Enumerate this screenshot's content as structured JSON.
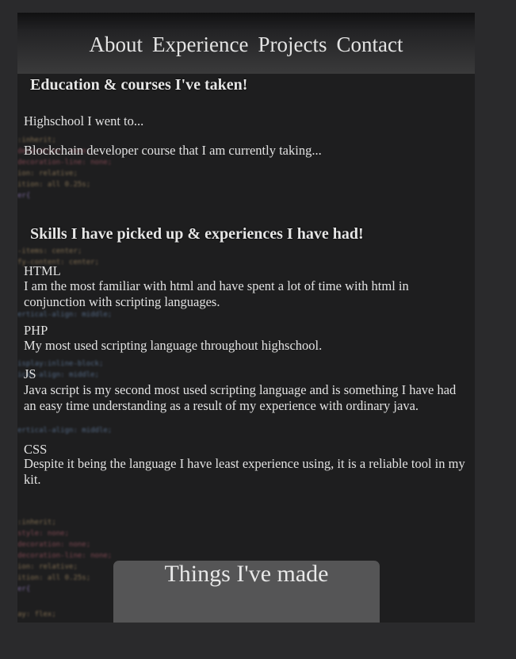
{
  "nav": {
    "items": [
      "About",
      "Experience",
      "Projects",
      "Contact"
    ]
  },
  "education": {
    "heading": "Education & courses I've taken!",
    "items": [
      "Highschool I went to...",
      "Blockchain developer course that I am currently taking..."
    ]
  },
  "skills": {
    "heading": "Skills I have picked up & experiences I have had!",
    "items": [
      {
        "name": "HTML",
        "description": "I am the most familiar with html and have spent a lot of time with html in conjunction with scripting languages."
      },
      {
        "name": "PHP",
        "description": "My most used scripting language throughout highschool."
      },
      {
        "name": "JS",
        "description": "Java script is my second most used scripting language and is something I have had an easy time understanding as a result of my experience with ordinary java."
      },
      {
        "name": "CSS",
        "description": "Despite it being the language I have least experience using, it is a reliable tool in my kit."
      }
    ]
  },
  "projects": {
    "heading": "Things I've made"
  },
  "background_code": [
    ":inherit;",
    "decoration: none;",
    "decoration-line: none;",
    "ion: relative;",
    "ition: all 0.25s;",
    "er{",
    "-items: center;",
    "fy-content: center;",
    "ertical-align: middle;",
    "isplay:inline-block;",
    "ical-align: middle;",
    "ertical-align: middle;",
    ":inherit;",
    "style: none;",
    "decoration: none;",
    "decoration-line: none;",
    "ion: relative;",
    "ition: all 0.25s;",
    "er{",
    "ay: flex;"
  ]
}
